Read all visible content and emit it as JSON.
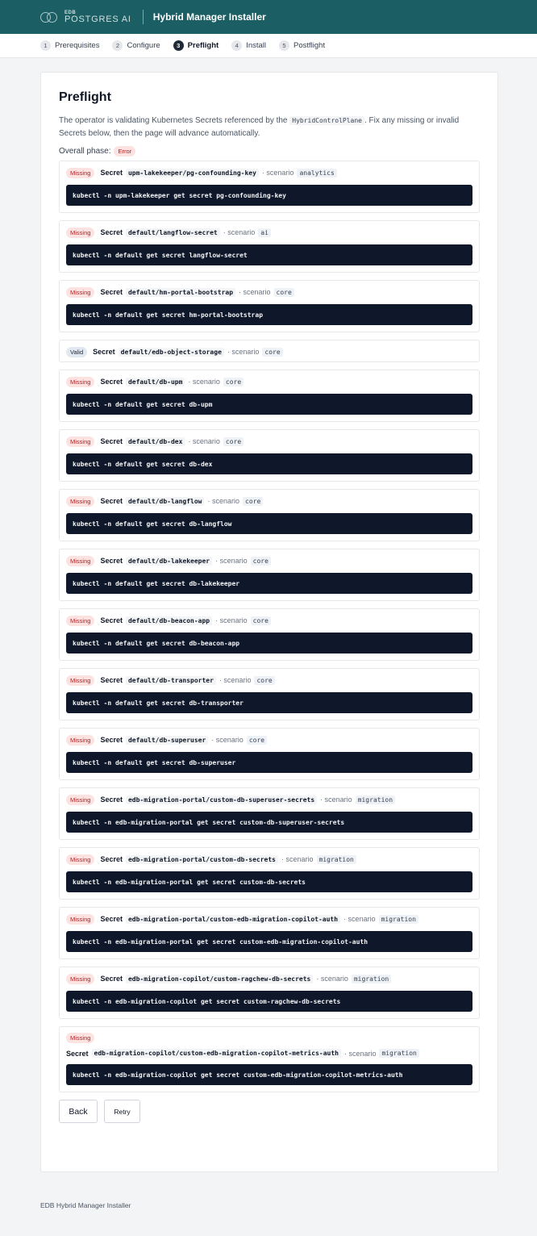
{
  "header": {
    "logo_edb": "EDB",
    "logo_brand": "POSTGRES AI",
    "title": "Hybrid Manager Installer"
  },
  "steps": [
    {
      "num": "1",
      "label": "Prerequisites",
      "active": false
    },
    {
      "num": "2",
      "label": "Configure",
      "active": false
    },
    {
      "num": "3",
      "label": "Preflight",
      "active": true
    },
    {
      "num": "4",
      "label": "Install",
      "active": false
    },
    {
      "num": "5",
      "label": "Postflight",
      "active": false
    }
  ],
  "page": {
    "title": "Preflight",
    "desc_before": "The operator is validating Kubernetes Secrets referenced by the ",
    "desc_code": "HybridControlPlane",
    "desc_after": ". Fix any missing or invalid Secrets below, then the page will advance automatically.",
    "phase_label": "Overall phase:",
    "phase_value": "Error"
  },
  "labels": {
    "secret": "Secret",
    "scenario": "· scenario"
  },
  "secrets": [
    {
      "status": "Missing",
      "name": "upm-lakekeeper/pg-confounding-key",
      "scenario": "analytics",
      "command": "kubectl -n upm-lakekeeper get secret pg-confounding-key"
    },
    {
      "status": "Missing",
      "name": "default/langflow-secret",
      "scenario": "ai",
      "command": "kubectl -n default get secret langflow-secret"
    },
    {
      "status": "Missing",
      "name": "default/hm-portal-bootstrap",
      "scenario": "core",
      "command": "kubectl -n default get secret hm-portal-bootstrap"
    },
    {
      "status": "Valid",
      "name": "default/edb-object-storage",
      "scenario": "core",
      "command": ""
    },
    {
      "status": "Missing",
      "name": "default/db-upm",
      "scenario": "core",
      "command": "kubectl -n default get secret db-upm"
    },
    {
      "status": "Missing",
      "name": "default/db-dex",
      "scenario": "core",
      "command": "kubectl -n default get secret db-dex"
    },
    {
      "status": "Missing",
      "name": "default/db-langflow",
      "scenario": "core",
      "command": "kubectl -n default get secret db-langflow"
    },
    {
      "status": "Missing",
      "name": "default/db-lakekeeper",
      "scenario": "core",
      "command": "kubectl -n default get secret db-lakekeeper"
    },
    {
      "status": "Missing",
      "name": "default/db-beacon-app",
      "scenario": "core",
      "command": "kubectl -n default get secret db-beacon-app"
    },
    {
      "status": "Missing",
      "name": "default/db-transporter",
      "scenario": "core",
      "command": "kubectl -n default get secret db-transporter"
    },
    {
      "status": "Missing",
      "name": "default/db-superuser",
      "scenario": "core",
      "command": "kubectl -n default get secret db-superuser"
    },
    {
      "status": "Missing",
      "name": "edb-migration-portal/custom-db-superuser-secrets",
      "scenario": "migration",
      "command": "kubectl -n edb-migration-portal get secret custom-db-superuser-secrets"
    },
    {
      "status": "Missing",
      "name": "edb-migration-portal/custom-db-secrets",
      "scenario": "migration",
      "command": "kubectl -n edb-migration-portal get secret custom-db-secrets"
    },
    {
      "status": "Missing",
      "name": "edb-migration-portal/custom-edb-migration-copilot-auth",
      "scenario": "migration",
      "command": "kubectl -n edb-migration-portal get secret custom-edb-migration-copilot-auth"
    },
    {
      "status": "Missing",
      "name": "edb-migration-copilot/custom-ragchew-db-secrets",
      "scenario": "migration",
      "command": "kubectl -n edb-migration-copilot get secret custom-ragchew-db-secrets"
    },
    {
      "status": "Missing",
      "name": "edb-migration-copilot/custom-edb-migration-copilot-metrics-auth",
      "scenario": "migration",
      "command": "kubectl -n edb-migration-copilot get secret custom-edb-migration-copilot-metrics-auth"
    }
  ],
  "actions": {
    "back": "Back",
    "retry": "Retry"
  },
  "footer": "EDB Hybrid Manager Installer"
}
